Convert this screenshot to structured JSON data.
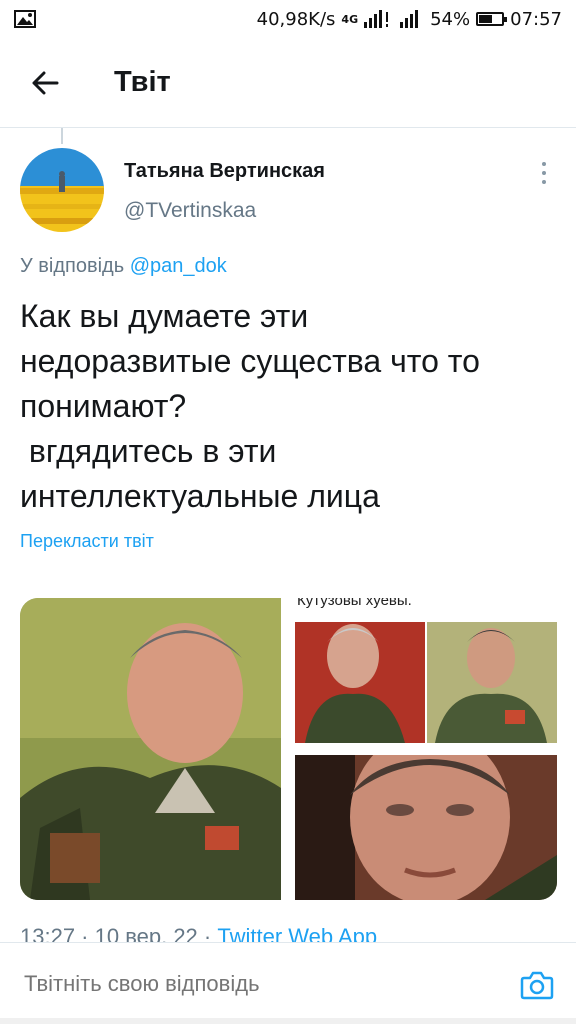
{
  "status_bar": {
    "net_speed": "40,98K/s",
    "network_type": "4G",
    "battery_percent": "54%",
    "battery_level": 0.54,
    "time": "07:57",
    "left_icon": "image-icon"
  },
  "header": {
    "title": "Твіт",
    "back_icon": "arrow-left-icon"
  },
  "tweet": {
    "author_name": "Татьяна Вертинская",
    "author_handle": "@TVertinskaa",
    "reply_prefix": "У відповідь",
    "reply_mention": "@pan_dok",
    "text": "Как вы думаете эти\nнедоразвитые существа что то\nпонимают?\n вгдядитесь в эти\nинтеллектуальные лица",
    "translate_label": "Перекласти твіт",
    "media": {
      "caption_b": "Кутузовы хуевы.",
      "count": 3
    },
    "meta_time": "13:27 · 10 вер. 22 · ",
    "meta_source": "Twitter Web App"
  },
  "reply_bar": {
    "placeholder": "Твітніть свою відповідь",
    "camera_icon": "camera-icon"
  },
  "colors": {
    "accent": "#1da1f2",
    "secondary_text": "#657786",
    "divider": "#e1e8ed"
  }
}
